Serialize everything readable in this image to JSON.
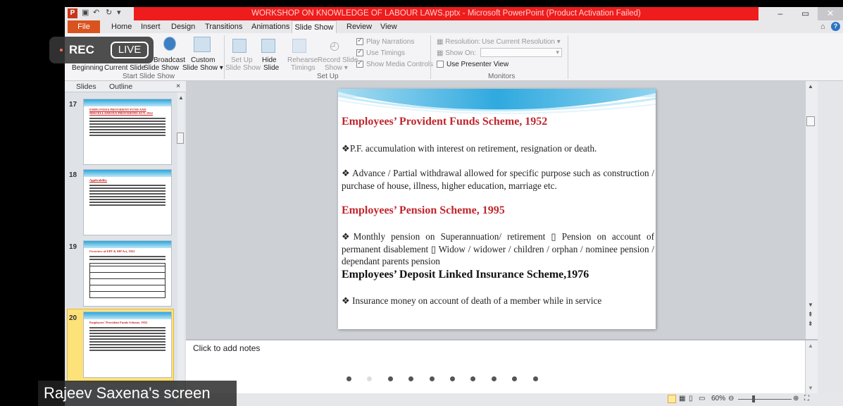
{
  "window": {
    "title": "WORKSHOP ON KNOWLEDGE OF LABOUR LAWS.pptx - Microsoft PowerPoint (Product Activation Failed)",
    "controls": [
      "–",
      "▭",
      "✕"
    ]
  },
  "tabs": [
    "File",
    "Home",
    "Insert",
    "Design",
    "Transitions",
    "Animations",
    "Slide Show",
    "Review",
    "View"
  ],
  "ribbon": {
    "start_group": {
      "buttons": [
        {
          "line1": "",
          "line2": "Beginning"
        },
        {
          "line1": "",
          "line2": "Current Slide"
        },
        {
          "line1": "Broadcast",
          "line2": "Slide Show"
        },
        {
          "line1": "Custom",
          "line2": "Slide Show ▾"
        }
      ],
      "label": "Start Slide Show"
    },
    "setup_group": {
      "buttons": [
        {
          "line1": "Set Up",
          "line2": "Slide Show"
        },
        {
          "line1": "Hide",
          "line2": "Slide"
        },
        {
          "line1": "Rehearse",
          "line2": "Timings"
        },
        {
          "line1": "Record Slide",
          "line2": "Show ▾"
        }
      ],
      "checks": [
        {
          "label": "Play Narrations",
          "checked": true
        },
        {
          "label": "Use Timings",
          "checked": true
        },
        {
          "label": "Show Media Controls",
          "checked": true
        }
      ],
      "label": "Set Up"
    },
    "monitors_group": {
      "resolution_label": "Resolution:",
      "resolution_value": "Use Current Resolution",
      "show_on_label": "Show On:",
      "presenter_view": "Use Presenter View",
      "label": "Monitors"
    }
  },
  "rec_overlay": {
    "rec": "REC",
    "live": "LIVE"
  },
  "left_panel": {
    "tabs": [
      "Slides",
      "Outline"
    ],
    "close": "×",
    "thumbnails": [
      {
        "num": "17",
        "title": "EMPLOYEES PROVIDENT FUND AND MISCELLANEOUS PROVISIONS ACT, 1952"
      },
      {
        "num": "18",
        "title": "Applicability"
      },
      {
        "num": "19",
        "title": "Overview of EPF & MP Act, 1952"
      },
      {
        "num": "20",
        "title": "Employees' Provident Funds Scheme, 1952"
      }
    ]
  },
  "slide": {
    "heading1": "Employees’ Provident Funds Scheme, 1952",
    "p1": "❖P.F. accumulation with interest on retirement, resignation or death.",
    "p2": "❖ Advance / Partial withdrawal allowed for specific purpose such as construction / purchase of house, illness, higher education, marriage etc.",
    "heading2": "Employees’ Pension Scheme, 1995",
    "p3": "❖Monthly pension on Superannuation/ retirement ▯ Pension on account of permanent disablement ▯ Widow / widower / children / orphan / nominee pension / dependant parents pension",
    "heading3": "Employees’ Deposit Linked Insurance Scheme,1976",
    "p4": "❖ Insurance money on account of death of a member while in service"
  },
  "notes": {
    "placeholder": "Click to add notes"
  },
  "status": {
    "zoom": "60%"
  },
  "share_label": "Rajeev Saxena's screen",
  "colors": {
    "title_red": "#ee1c1c",
    "file_tab": "#d9531e",
    "heading_red": "#c0262d",
    "selected_thumb": "#fde27a"
  }
}
